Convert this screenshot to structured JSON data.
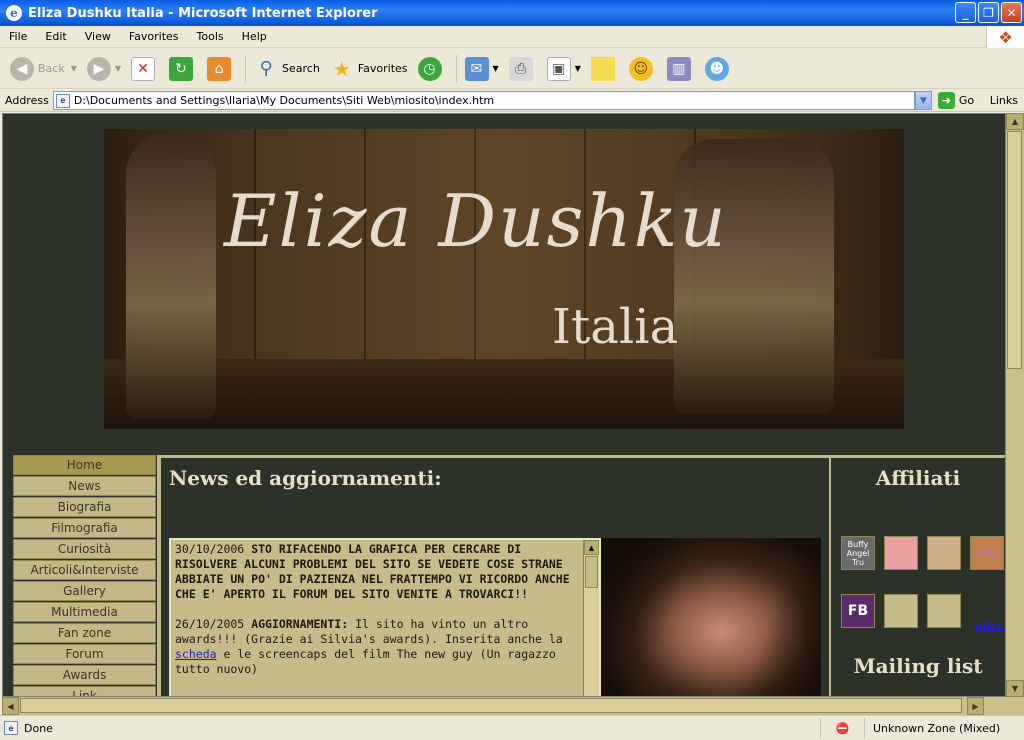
{
  "window": {
    "title": "Eliza Dushku Italia - Microsoft Internet Explorer"
  },
  "menu": [
    "File",
    "Edit",
    "View",
    "Favorites",
    "Tools",
    "Help"
  ],
  "toolbar": {
    "back": "Back",
    "search": "Search",
    "favorites": "Favorites"
  },
  "address": {
    "label": "Address",
    "url": "D:\\Documents and Settings\\Ilaria\\My Documents\\Siti Web\\miosito\\index.htm",
    "go": "Go",
    "links": "Links"
  },
  "banner": {
    "title": "Eliza Dushku",
    "subtitle": "Italia"
  },
  "nav": [
    "Home",
    "News",
    "Biografia",
    "Filmografia",
    "Curiosità",
    "Articoli&Interviste",
    "Gallery",
    "Multimedia",
    "Fan zone",
    "Forum",
    "Awards",
    "Link"
  ],
  "news": {
    "heading": "News ed aggiornamenti:",
    "entry1_date": "30/10/2006",
    "entry1_text": "STO RIFACENDO LA GRAFICA PER CERCARE DI RISOLVERE ALCUNI PROBLEMI DEL SITO SE VEDETE COSE STRANE ABBIATE UN PO' DI PAZIENZA NEL FRATTEMPO VI RICORDO ANCHE CHE E' APERTO IL FORUM DEL SITO VENITE A TROVARCI!!",
    "entry2_date": "26/10/2005",
    "entry2_label": "AGGIORNAMENTI:",
    "entry2_text_a": "Il sito ha vinto un altro awards!!! (Grazie ai Silvia's awards). Inserita anche la",
    "entry2_link": "scheda",
    "entry2_text_b": "e le screencaps del film The new guy (Un ragazzo tutto nuovo)"
  },
  "affiliati": {
    "heading": "Affiliati",
    "buttons": [
      {
        "label": "Buffy Angel Tru",
        "color": "#6a6a6a"
      },
      {
        "label": "",
        "color": "#e8a0a0"
      },
      {
        "label": "",
        "color": "#d0b088"
      },
      {
        "label": "buffy",
        "color": "#c08050"
      },
      {
        "label": "FB",
        "color": "#5a2a6a"
      },
      {
        "label": "",
        "color": "#c6bc8a"
      },
      {
        "label": "",
        "color": "#c6bc8a"
      }
    ],
    "more_link": "altri..."
  },
  "mailing": {
    "heading": "Mailing list"
  },
  "status": {
    "text": "Done",
    "zone": "Unknown Zone (Mixed)"
  }
}
